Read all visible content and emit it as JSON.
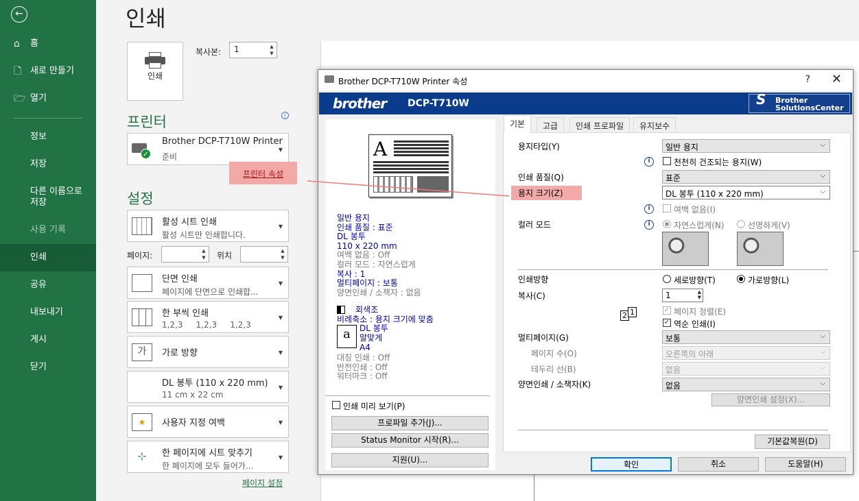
{
  "sidebar": {
    "items": [
      {
        "label": "홈",
        "icon": "home-icon"
      },
      {
        "label": "새로 만들기",
        "icon": "new-document-icon"
      },
      {
        "label": "열기",
        "icon": "open-folder-icon"
      },
      {
        "label": "정보"
      },
      {
        "label": "저장"
      },
      {
        "label": "다른 이름으로 저장"
      },
      {
        "label": "사용 기록"
      },
      {
        "label": "인쇄"
      },
      {
        "label": "공유"
      },
      {
        "label": "내보내기"
      },
      {
        "label": "게시"
      },
      {
        "label": "닫기"
      }
    ]
  },
  "print": {
    "title": "인쇄",
    "button_label": "인쇄",
    "copies_label": "복사본:",
    "copies_value": "1"
  },
  "printer": {
    "heading": "프린터",
    "name": "Brother DCP-T710W Printer",
    "status": "준비",
    "properties_link": "프린터 속성"
  },
  "settings": {
    "heading": "설정",
    "sheets": {
      "l1": "활성 시트 인쇄",
      "l2": "활성 시트만 인쇄합니다."
    },
    "pages_label": "페이지:",
    "to_label": "위치",
    "sided": {
      "l1": "단면 인쇄",
      "l2": "페이지에 단면으로 인쇄합..."
    },
    "collate": {
      "l1": "한 부씩 인쇄",
      "l2": "1,2,3     1,2,3     1,2,3"
    },
    "orientation": {
      "l1": "가로 방향"
    },
    "paper": {
      "l1": "DL 봉투 (110 x 220 mm)",
      "l2": "11 cm x 22 cm"
    },
    "margins": {
      "l1": "사용자 지정 여백"
    },
    "scaling": {
      "l1": "한 페이지에 시트 맞추기",
      "l2": "한 페이지에 모두 들어가..."
    },
    "page_setup_link": "페이지 설정"
  },
  "dialog": {
    "title": "Brother DCP-T710W Printer 속성",
    "help": "?",
    "close": "✕",
    "brand": "brother",
    "model": "DCP-T710W",
    "solutions_line1": "Brother",
    "solutions_line2": "SolutionsCenter",
    "summary": {
      "blue1": [
        "일반 용지",
        "인쇄 품질 : 표준",
        "DL 봉투",
        "110 x 220 mm"
      ],
      "gray1": [
        "여백 없음 : Off",
        "컬러 모드 : 자연스럽게"
      ],
      "blue2": [
        "복사 : 1",
        "멀티페이지 : 보통"
      ],
      "gray2": [
        "양면인쇄 / 소책자 : 없음"
      ],
      "grayscale": "회색조",
      "scale": "비례축소 : 용지 크기에 맞춤",
      "env": "DL 봉투",
      "fit": "알맞게",
      "a4": "A4",
      "gray3": [
        "대칭 인쇄 : Off",
        "반전인쇄 : Off",
        "워터마크 : Off"
      ]
    },
    "preview_check": "인쇄 미리 보기(P)",
    "add_profile": "프로파일 추가(J)...",
    "status_monitor": "Status Monitor 시작(R)...",
    "support": "지원(U)...",
    "tabs": [
      "기본",
      "고급",
      "인쇄 프로파일",
      "유지보수"
    ],
    "media_type_label": "용지타입(Y)",
    "media_type": "일반 용지",
    "slow_dry": "천천히 건조되는 용지(W)",
    "quality_label": "인쇄 품질(Q)",
    "quality": "표준",
    "paper_size_label": "용지 크기(Z)",
    "paper_size": "DL 봉투 (110 x 220 mm)",
    "borderless": "여백 없음(I)",
    "color_mode_label": "컬러 모드",
    "color_natural": "자연스럽게(N)",
    "color_vivid": "선명하게(V)",
    "orientation_label": "인쇄방향",
    "portrait": "세로방향(T)",
    "landscape": "가로방향(L)",
    "copies_label": "복사(C)",
    "copies": "1",
    "collate": "페이지 정렬(E)",
    "reverse": "역순 인쇄(I)",
    "multipage_label": "멀티페이지(G)",
    "multipage": "보통",
    "page_order_label": "페이지 수(O)",
    "page_order": "오른쪽의 아래",
    "border_label": "테두리 선(B)",
    "border": "없음",
    "duplex_label": "양면인쇄 / 소책자(K)",
    "duplex": "없음",
    "duplex_settings": "양면인쇄 설정(X)...",
    "default": "기본값복원(D)",
    "ok": "확인",
    "cancel": "취소",
    "help_btn": "도움말(H)"
  },
  "colors": {
    "excel_green": "#217346",
    "brother_blue": "#0b3c8c",
    "highlight": "#f4a9a9"
  }
}
